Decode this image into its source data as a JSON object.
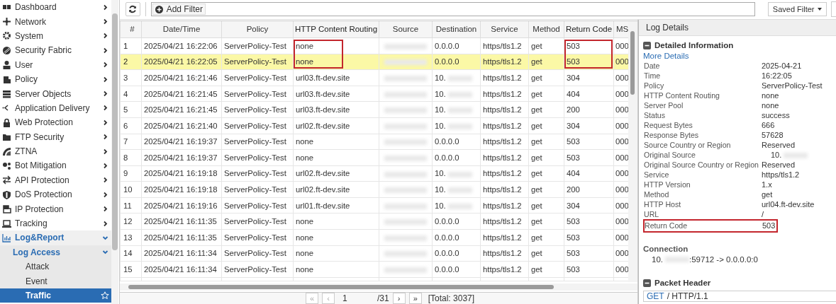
{
  "sidebar": {
    "items": [
      {
        "label": "Dashboard",
        "expanded": false,
        "selected": false
      },
      {
        "label": "Network",
        "expanded": false,
        "selected": false
      },
      {
        "label": "System",
        "expanded": false,
        "selected": false
      },
      {
        "label": "Security Fabric",
        "expanded": false,
        "selected": false
      },
      {
        "label": "User",
        "expanded": false,
        "selected": false
      },
      {
        "label": "Policy",
        "expanded": false,
        "selected": false
      },
      {
        "label": "Server Objects",
        "expanded": false,
        "selected": false
      },
      {
        "label": "Application Delivery",
        "expanded": false,
        "selected": false
      },
      {
        "label": "Web Protection",
        "expanded": false,
        "selected": false
      },
      {
        "label": "FTP Security",
        "expanded": false,
        "selected": false
      },
      {
        "label": "ZTNA",
        "expanded": false,
        "selected": false
      },
      {
        "label": "Bot Mitigation",
        "expanded": false,
        "selected": false
      },
      {
        "label": "API Protection",
        "expanded": false,
        "selected": false
      },
      {
        "label": "DoS Protection",
        "expanded": false,
        "selected": false
      },
      {
        "label": "IP Protection",
        "expanded": false,
        "selected": false
      },
      {
        "label": "Tracking",
        "expanded": false,
        "selected": false
      },
      {
        "label": "Log&Report",
        "expanded": true,
        "selected": false,
        "children": [
          {
            "label": "Log Access",
            "expanded": true,
            "selected": false,
            "children": [
              {
                "label": "Attack",
                "selected": false
              },
              {
                "label": "Event",
                "selected": false
              },
              {
                "label": "Traffic",
                "selected": true
              }
            ]
          }
        ]
      }
    ]
  },
  "toolbar": {
    "add_filter": "Add Filter",
    "saved_filter": "Saved Filter"
  },
  "table": {
    "columns": [
      {
        "label": "#",
        "callout": false
      },
      {
        "label": "Date/Time",
        "callout": false
      },
      {
        "label": "Policy",
        "callout": false
      },
      {
        "label": "HTTP Content Routing",
        "callout": true
      },
      {
        "label": "Source",
        "callout": false
      },
      {
        "label": "Destination",
        "callout": false
      },
      {
        "label": "Service",
        "callout": false
      },
      {
        "label": "Method",
        "callout": false
      },
      {
        "label": "Return Code",
        "callout": true
      },
      {
        "label": "MS",
        "callout": false
      }
    ],
    "rows": [
      {
        "number": "1",
        "date_time": "2025/04/21 16:22:06",
        "policy": "ServerPolicy-Test",
        "routing": "none",
        "source_redacted": true,
        "destination": "0.0.0.0",
        "destination_redacted": false,
        "service": "https/tls1.2",
        "method": "get",
        "return_code": "503",
        "ms": "000",
        "selected": false,
        "callout": true
      },
      {
        "number": "2",
        "date_time": "2025/04/21 16:22:05",
        "policy": "ServerPolicy-Test",
        "routing": "none",
        "source_redacted": true,
        "destination": "0.0.0.0",
        "destination_redacted": false,
        "service": "https/tls1.2",
        "method": "get",
        "return_code": "503",
        "ms": "000",
        "selected": true,
        "callout": true
      },
      {
        "number": "3",
        "date_time": "2025/04/21 16:21:46",
        "policy": "ServerPolicy-Test",
        "routing": "url03.ft-dev.site",
        "source_redacted": true,
        "destination": "10.",
        "destination_redacted": true,
        "service": "https/tls1.2",
        "method": "get",
        "return_code": "304",
        "ms": "000",
        "selected": false,
        "callout": false
      },
      {
        "number": "4",
        "date_time": "2025/04/21 16:21:45",
        "policy": "ServerPolicy-Test",
        "routing": "url03.ft-dev.site",
        "source_redacted": true,
        "destination": "10.",
        "destination_redacted": true,
        "service": "https/tls1.2",
        "method": "get",
        "return_code": "404",
        "ms": "000",
        "selected": false,
        "callout": false
      },
      {
        "number": "5",
        "date_time": "2025/04/21 16:21:45",
        "policy": "ServerPolicy-Test",
        "routing": "url03.ft-dev.site",
        "source_redacted": true,
        "destination": "10.",
        "destination_redacted": true,
        "service": "https/tls1.2",
        "method": "get",
        "return_code": "200",
        "ms": "000",
        "selected": false,
        "callout": false
      },
      {
        "number": "6",
        "date_time": "2025/04/21 16:21:40",
        "policy": "ServerPolicy-Test",
        "routing": "url02.ft-dev.site",
        "source_redacted": true,
        "destination": "10.",
        "destination_redacted": true,
        "service": "https/tls1.2",
        "method": "get",
        "return_code": "304",
        "ms": "000",
        "selected": false,
        "callout": false
      },
      {
        "number": "7",
        "date_time": "2025/04/21 16:19:37",
        "policy": "ServerPolicy-Test",
        "routing": "none",
        "source_redacted": true,
        "destination": "0.0.0.0",
        "destination_redacted": false,
        "service": "https/tls1.2",
        "method": "get",
        "return_code": "503",
        "ms": "000",
        "selected": false,
        "callout": false
      },
      {
        "number": "8",
        "date_time": "2025/04/21 16:19:37",
        "policy": "ServerPolicy-Test",
        "routing": "none",
        "source_redacted": true,
        "destination": "0.0.0.0",
        "destination_redacted": false,
        "service": "https/tls1.2",
        "method": "get",
        "return_code": "503",
        "ms": "000",
        "selected": false,
        "callout": false
      },
      {
        "number": "9",
        "date_time": "2025/04/21 16:19:18",
        "policy": "ServerPolicy-Test",
        "routing": "url02.ft-dev.site",
        "source_redacted": true,
        "destination": "10.",
        "destination_redacted": true,
        "service": "https/tls1.2",
        "method": "get",
        "return_code": "404",
        "ms": "000",
        "selected": false,
        "callout": false
      },
      {
        "number": "10",
        "date_time": "2025/04/21 16:19:18",
        "policy": "ServerPolicy-Test",
        "routing": "url02.ft-dev.site",
        "source_redacted": true,
        "destination": "10.",
        "destination_redacted": true,
        "service": "https/tls1.2",
        "method": "get",
        "return_code": "200",
        "ms": "000",
        "selected": false,
        "callout": false
      },
      {
        "number": "11",
        "date_time": "2025/04/21 16:19:16",
        "policy": "ServerPolicy-Test",
        "routing": "url01.ft-dev.site",
        "source_redacted": true,
        "destination": "10.",
        "destination_redacted": true,
        "service": "https/tls1.2",
        "method": "get",
        "return_code": "304",
        "ms": "000",
        "selected": false,
        "callout": false
      },
      {
        "number": "12",
        "date_time": "2025/04/21 16:11:35",
        "policy": "ServerPolicy-Test",
        "routing": "none",
        "source_redacted": true,
        "destination": "0.0.0.0",
        "destination_redacted": false,
        "service": "https/tls1.2",
        "method": "get",
        "return_code": "503",
        "ms": "000",
        "selected": false,
        "callout": false
      },
      {
        "number": "13",
        "date_time": "2025/04/21 16:11:35",
        "policy": "ServerPolicy-Test",
        "routing": "none",
        "source_redacted": true,
        "destination": "0.0.0.0",
        "destination_redacted": false,
        "service": "https/tls1.2",
        "method": "get",
        "return_code": "503",
        "ms": "000",
        "selected": false,
        "callout": false
      },
      {
        "number": "14",
        "date_time": "2025/04/21 16:11:34",
        "policy": "ServerPolicy-Test",
        "routing": "none",
        "source_redacted": true,
        "destination": "0.0.0.0",
        "destination_redacted": false,
        "service": "https/tls1.2",
        "method": "get",
        "return_code": "503",
        "ms": "000",
        "selected": false,
        "callout": false
      },
      {
        "number": "15",
        "date_time": "2025/04/21 16:11:34",
        "policy": "ServerPolicy-Test",
        "routing": "none",
        "source_redacted": true,
        "destination": "0.0.0.0",
        "destination_redacted": false,
        "service": "https/tls1.2",
        "method": "get",
        "return_code": "503",
        "ms": "000",
        "selected": false,
        "callout": false
      }
    ]
  },
  "pagination": {
    "first": "«",
    "previous": "‹",
    "next": "›",
    "last": "»",
    "page": "1",
    "pages": "/31",
    "total": "[Total: 3037]"
  },
  "details": {
    "title": "Log Details",
    "section_title": "Detailed Information",
    "more_details": "More Details",
    "fields": [
      {
        "label": "Date",
        "value": "2025-04-21",
        "callout": false
      },
      {
        "label": "Time",
        "value": "16:22:05",
        "callout": false
      },
      {
        "label": "Policy",
        "value": "ServerPolicy-Test",
        "callout": false
      },
      {
        "label": "HTTP Content Routing",
        "value": "none",
        "callout": false
      },
      {
        "label": "Server Pool",
        "value": "none",
        "callout": false
      },
      {
        "label": "Status",
        "value": "success",
        "callout": false
      },
      {
        "label": "Request Bytes",
        "value": "666",
        "callout": false
      },
      {
        "label": "Response Bytes",
        "value": "57628",
        "callout": false
      },
      {
        "label": "Source Country or Region",
        "value": "Reserved",
        "callout": false
      },
      {
        "label": "Original Source",
        "value": "10.",
        "redacted": true,
        "callout": false
      },
      {
        "label": "Original Source Country or Region",
        "value": "Reserved",
        "callout": false
      },
      {
        "label": "Service",
        "value": "https/tls1.2",
        "callout": false
      },
      {
        "label": "HTTP Version",
        "value": "1.x",
        "callout": false
      },
      {
        "label": "Method",
        "value": "get",
        "callout": false
      },
      {
        "label": "HTTP Host",
        "value": "url04.ft-dev.site",
        "callout": false
      },
      {
        "label": "URL",
        "value": "/",
        "callout": false
      },
      {
        "label": "Return Code",
        "value": "503",
        "callout": true
      }
    ],
    "connection_title": "Connection",
    "connection_start": "10.",
    "connection_end": ":59712 -> 0.0.0.0:0",
    "packet_title": "Packet Header",
    "packet_method": "GET",
    "packet_rest": "/ HTTP/1.1"
  }
}
